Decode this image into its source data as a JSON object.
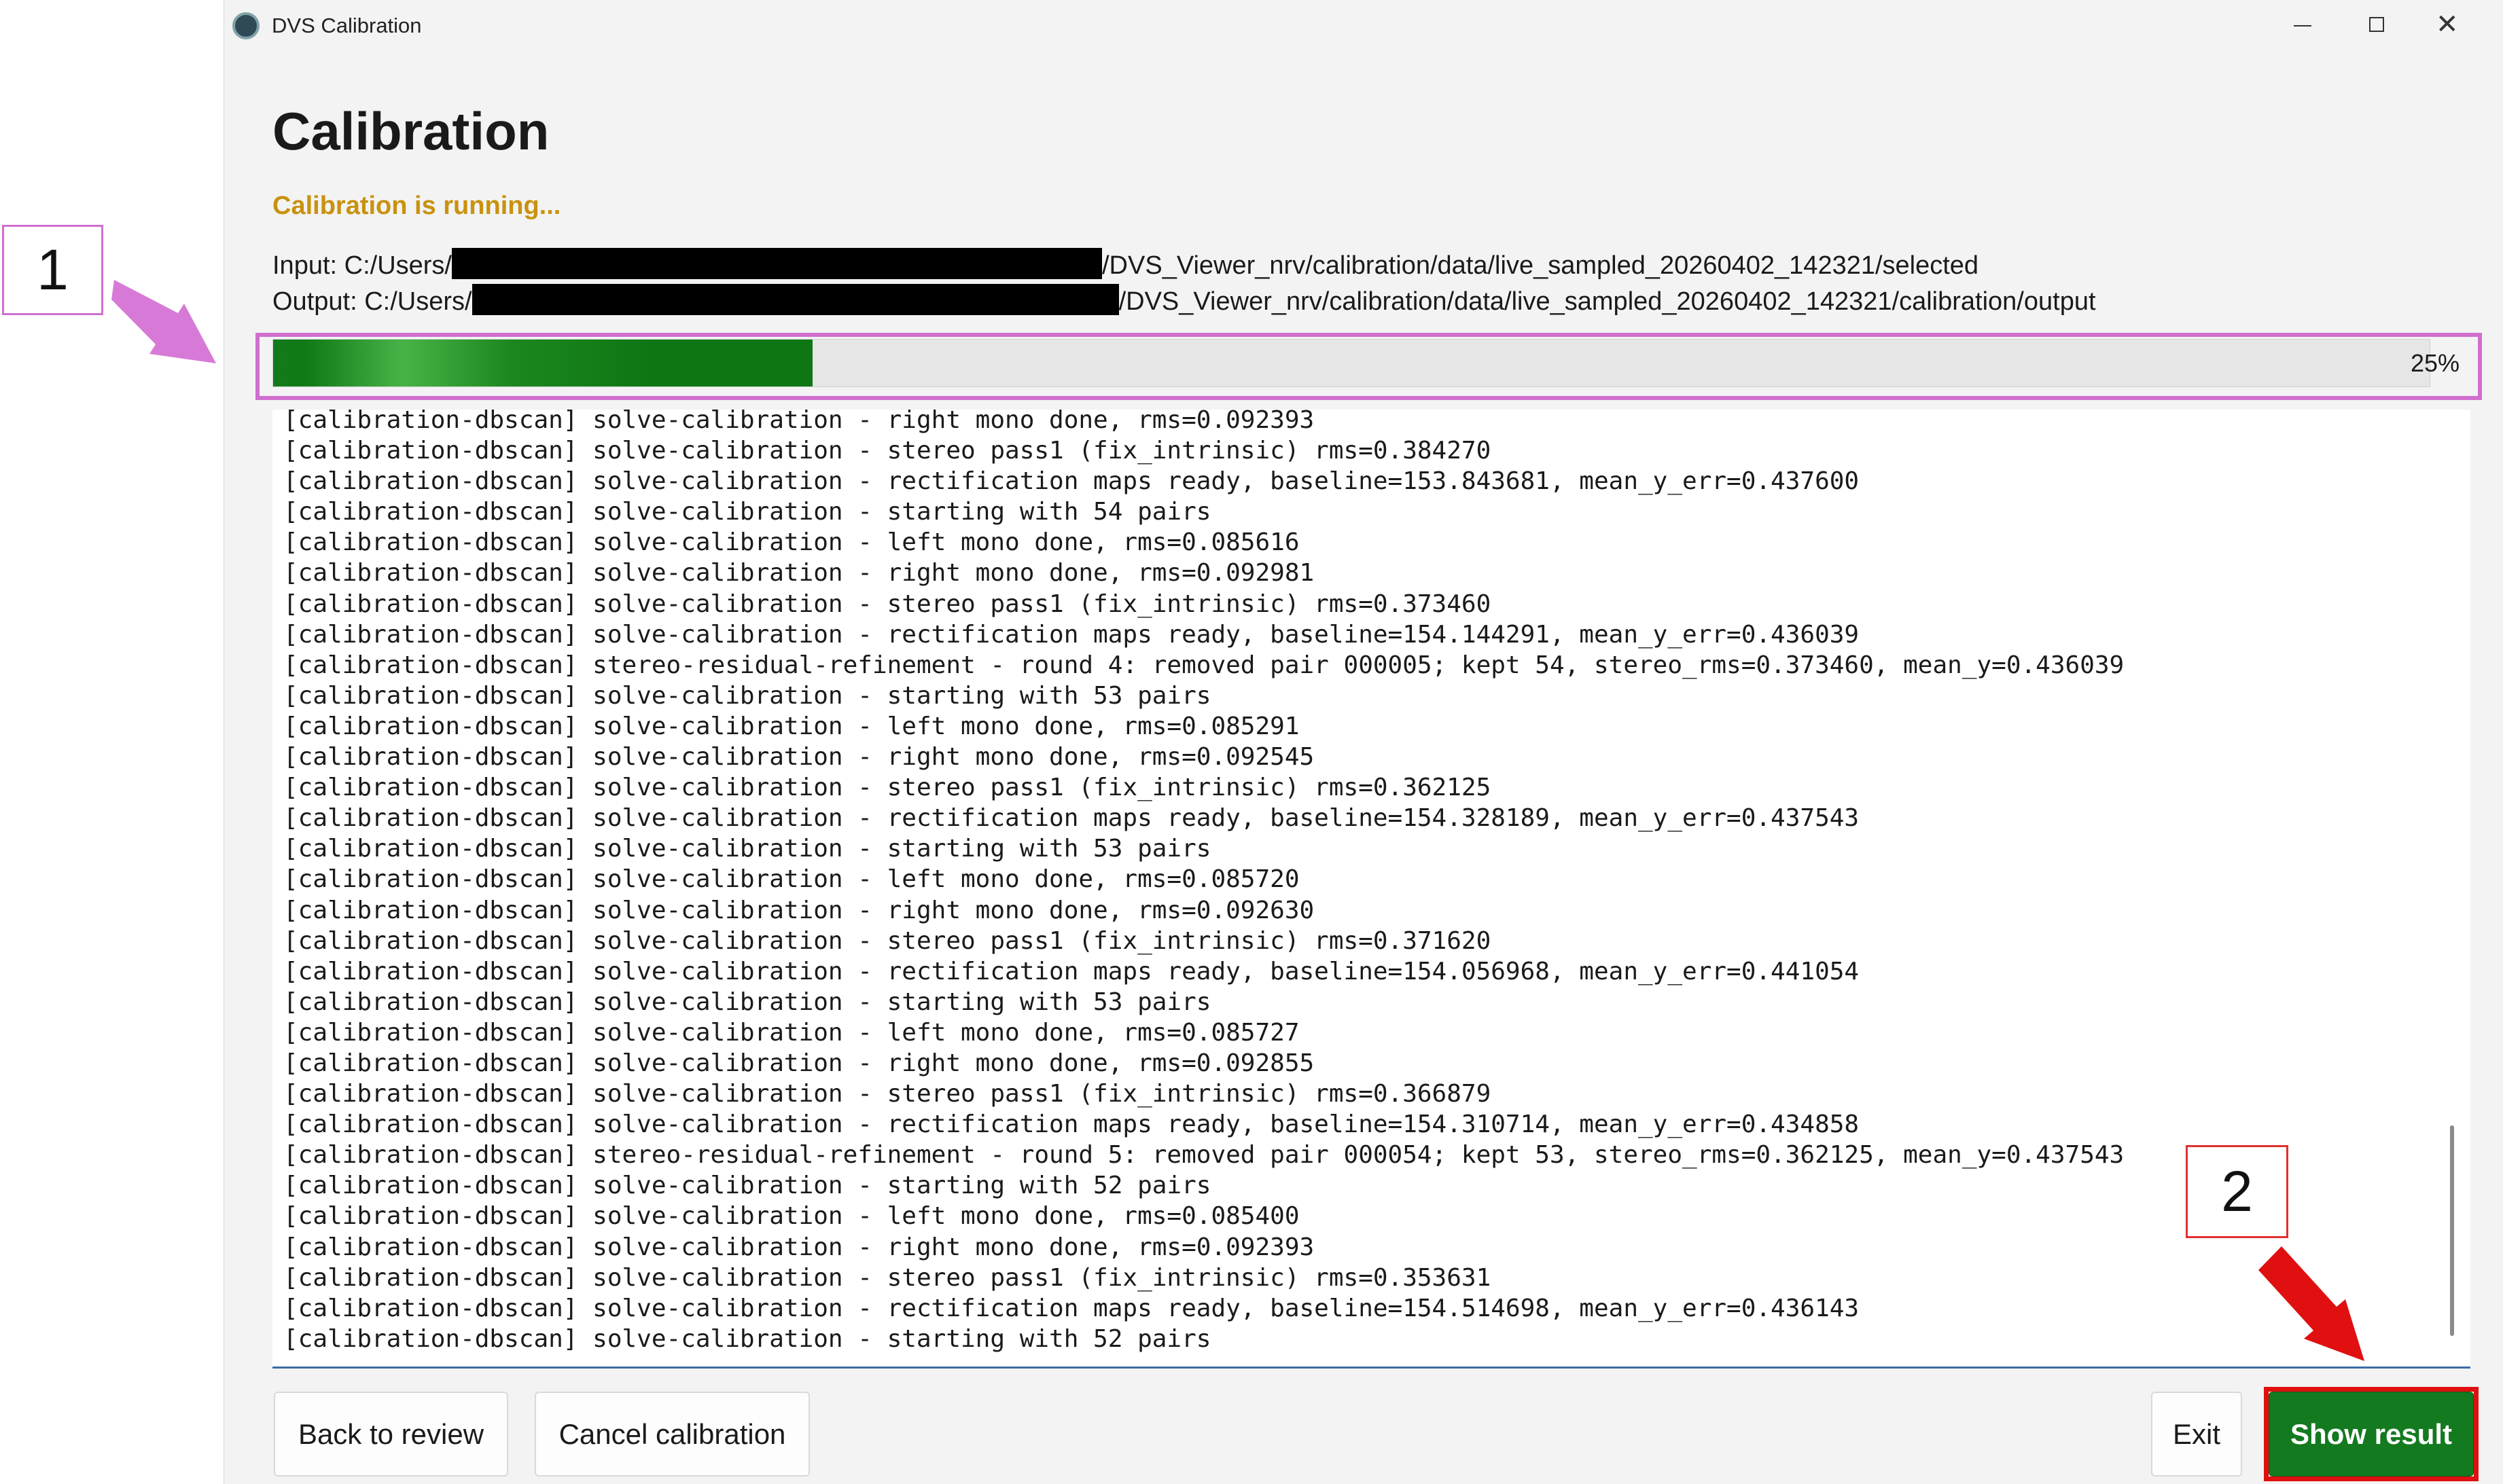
{
  "window": {
    "title": "DVS Calibration",
    "controls": {
      "minimize_icon": "minimize-icon",
      "maximize_icon": "maximize-icon",
      "close_symbol": "✕"
    }
  },
  "header": {
    "title": "Calibration",
    "status": "Calibration is running...",
    "status_color": "#c9920e"
  },
  "paths": {
    "input_label": "Input:",
    "input_prefix": "C:/Users/",
    "input_suffix": "/DVS_Viewer_nrv/calibration/data/live_sampled_20260402_142321/selected",
    "output_label": "Output:",
    "output_prefix": "C:/Users/",
    "output_suffix": "/DVS_Viewer_nrv/calibration/data/live_sampled_20260402_142321/calibration/output"
  },
  "progress": {
    "value": 0.25,
    "label": "25%",
    "fill_color": "#0e7614"
  },
  "log": {
    "lines": [
      "[calibration-dbscan] solve-calibration - right mono done, rms=0.092393",
      "[calibration-dbscan] solve-calibration - stereo pass1 (fix_intrinsic) rms=0.384270",
      "[calibration-dbscan] solve-calibration - rectification maps ready, baseline=153.843681, mean_y_err=0.437600",
      "[calibration-dbscan] solve-calibration - starting with 54 pairs",
      "[calibration-dbscan] solve-calibration - left mono done, rms=0.085616",
      "[calibration-dbscan] solve-calibration - right mono done, rms=0.092981",
      "[calibration-dbscan] solve-calibration - stereo pass1 (fix_intrinsic) rms=0.373460",
      "[calibration-dbscan] solve-calibration - rectification maps ready, baseline=154.144291, mean_y_err=0.436039",
      "[calibration-dbscan] stereo-residual-refinement - round 4: removed pair 000005; kept 54, stereo_rms=0.373460, mean_y=0.436039",
      "[calibration-dbscan] solve-calibration - starting with 53 pairs",
      "[calibration-dbscan] solve-calibration - left mono done, rms=0.085291",
      "[calibration-dbscan] solve-calibration - right mono done, rms=0.092545",
      "[calibration-dbscan] solve-calibration - stereo pass1 (fix_intrinsic) rms=0.362125",
      "[calibration-dbscan] solve-calibration - rectification maps ready, baseline=154.328189, mean_y_err=0.437543",
      "[calibration-dbscan] solve-calibration - starting with 53 pairs",
      "[calibration-dbscan] solve-calibration - left mono done, rms=0.085720",
      "[calibration-dbscan] solve-calibration - right mono done, rms=0.092630",
      "[calibration-dbscan] solve-calibration - stereo pass1 (fix_intrinsic) rms=0.371620",
      "[calibration-dbscan] solve-calibration - rectification maps ready, baseline=154.056968, mean_y_err=0.441054",
      "[calibration-dbscan] solve-calibration - starting with 53 pairs",
      "[calibration-dbscan] solve-calibration - left mono done, rms=0.085727",
      "[calibration-dbscan] solve-calibration - right mono done, rms=0.092855",
      "[calibration-dbscan] solve-calibration - stereo pass1 (fix_intrinsic) rms=0.366879",
      "[calibration-dbscan] solve-calibration - rectification maps ready, baseline=154.310714, mean_y_err=0.434858",
      "[calibration-dbscan] stereo-residual-refinement - round 5: removed pair 000054; kept 53, stereo_rms=0.362125, mean_y=0.437543",
      "[calibration-dbscan] solve-calibration - starting with 52 pairs",
      "[calibration-dbscan] solve-calibration - left mono done, rms=0.085400",
      "[calibration-dbscan] solve-calibration - right mono done, rms=0.092393",
      "[calibration-dbscan] solve-calibration - stereo pass1 (fix_intrinsic) rms=0.353631",
      "[calibration-dbscan] solve-calibration - rectification maps ready, baseline=154.514698, mean_y_err=0.436143",
      "[calibration-dbscan] solve-calibration - starting with 52 pairs"
    ]
  },
  "buttons": {
    "back": "Back to review",
    "cancel": "Cancel calibration",
    "exit": "Exit",
    "show_result": "Show result",
    "show_result_color": "#137a1f"
  },
  "annotations": {
    "callout_1": "1",
    "callout_2": "2",
    "callout_1_color": "#cf6fcf",
    "callout_2_color": "#e01010"
  }
}
